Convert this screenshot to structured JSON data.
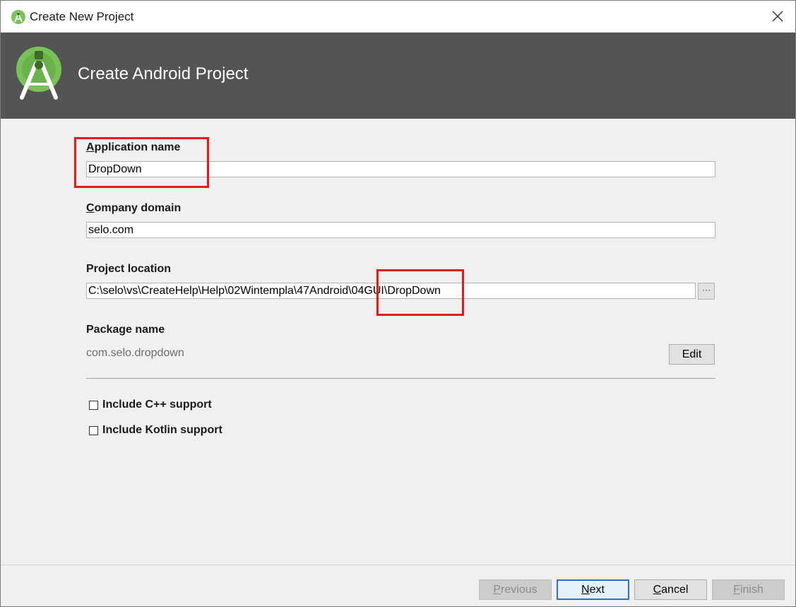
{
  "window": {
    "title": "Create New Project"
  },
  "banner": {
    "heading": "Create Android Project"
  },
  "form": {
    "app_name": {
      "label_first": "A",
      "label_rest": "pplication name",
      "value": "DropDown"
    },
    "company_domain": {
      "label_first": "C",
      "label_rest": "ompany domain",
      "value": "selo.com"
    },
    "project_location": {
      "label": "Project location",
      "value": "C:\\selo\\vs\\CreateHelp\\Help\\02Wintempla\\47Android\\04GUI\\DropDown",
      "browse_label": "···"
    },
    "package": {
      "label": "Package name",
      "value": "com.selo.dropdown",
      "edit_label": "Edit"
    },
    "options": [
      {
        "label": "Include C++ support",
        "checked": false
      },
      {
        "label": "Include Kotlin support",
        "checked": false
      }
    ]
  },
  "footer": {
    "previous_first": "P",
    "previous_rest": "revious",
    "next_first": "N",
    "next_rest": "ext",
    "cancel_first": "C",
    "cancel_rest": "ancel",
    "finish_first": "F",
    "finish_rest": "inish"
  },
  "colors": {
    "banner": "#545454",
    "highlight": "#e31b1b",
    "android_green": "#78c257",
    "default_button_border": "#2f6fd0"
  },
  "icons": {
    "app": "android-studio-icon",
    "close": "close-icon",
    "logo": "android-studio-logo"
  }
}
